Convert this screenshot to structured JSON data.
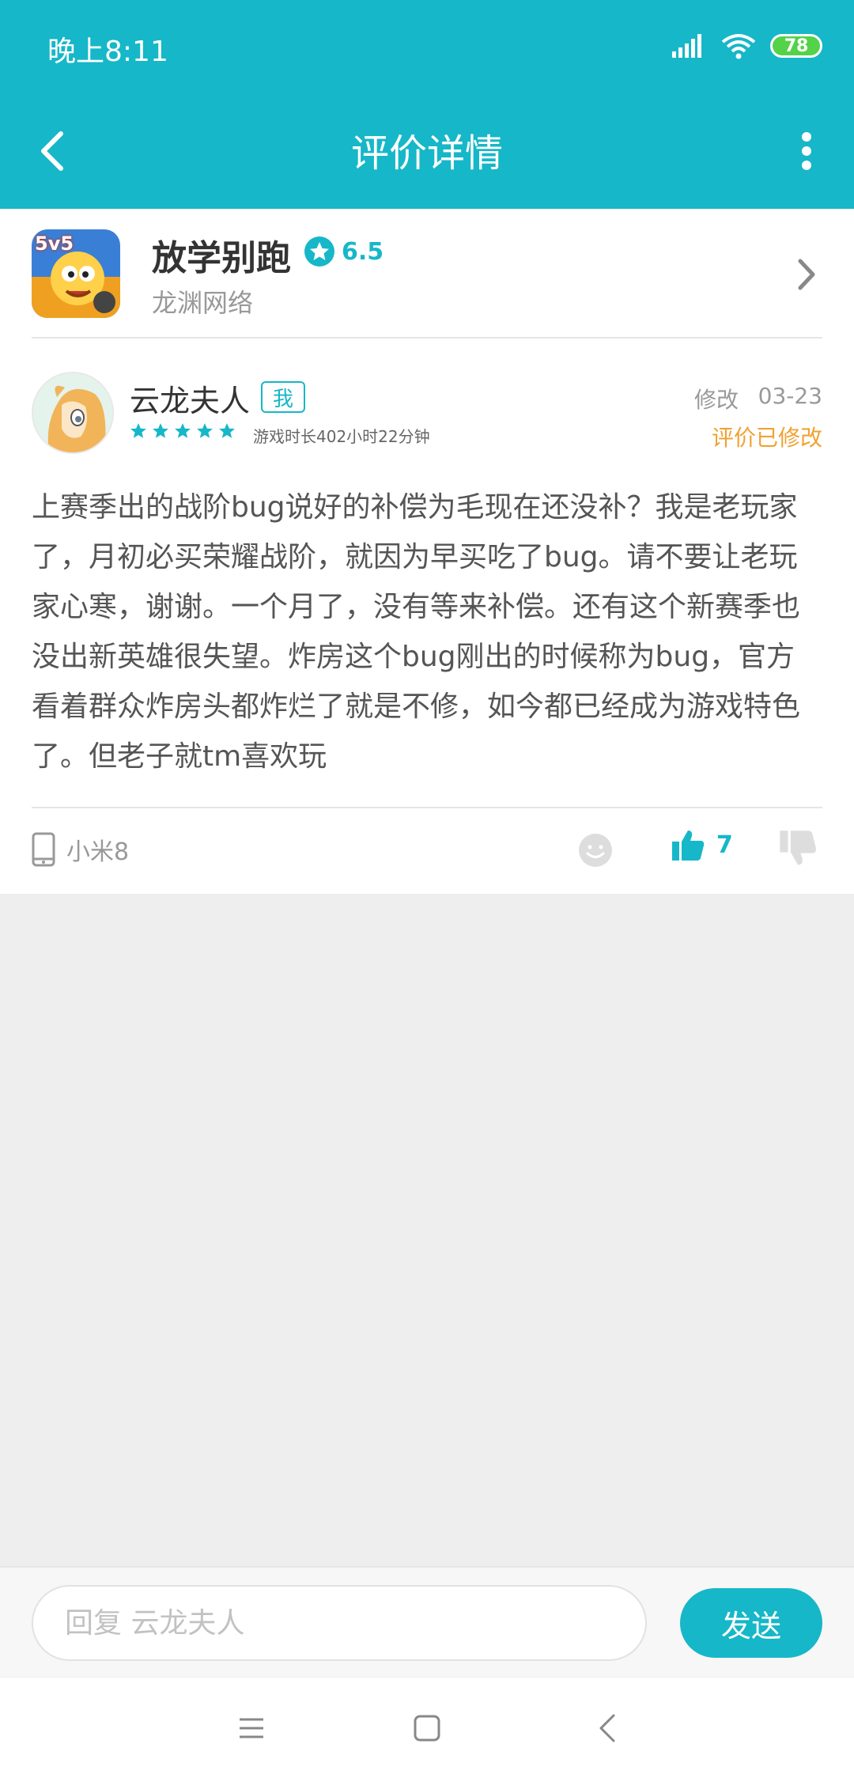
{
  "status_bar": {
    "time": "晚上8:11",
    "battery": "78"
  },
  "header": {
    "title": "评价详情"
  },
  "app": {
    "name": "放学别跑",
    "rating": "6.5",
    "developer": "龙渊网络",
    "icon_text": "5v5"
  },
  "review": {
    "user_name": "云龙夫人",
    "me_badge": "我",
    "stars": 5,
    "playtime": "游戏时长402小时22分钟",
    "edit_label": "修改",
    "date": "03-23",
    "edited_note": "评价已修改",
    "body": "上赛季出的战阶bug说好的补偿为毛现在还没补？我是老玩家了，月初必买荣耀战阶，就因为早买吃了bug。请不要让老玩家心寒，谢谢。一个月了，没有等来补偿。还有这个新赛季也没出新英雄很失望。炸房这个bug刚出的时候称为bug，官方看着群众炸房头都炸烂了就是不修，如今都已经成为游戏特色了。但老子就tm喜欢玩",
    "device": "小米8",
    "likes": "7"
  },
  "reply": {
    "placeholder": "回复 云龙夫人",
    "send_label": "发送"
  },
  "colors": {
    "accent": "#16b7c8",
    "edited": "#f0a233"
  }
}
